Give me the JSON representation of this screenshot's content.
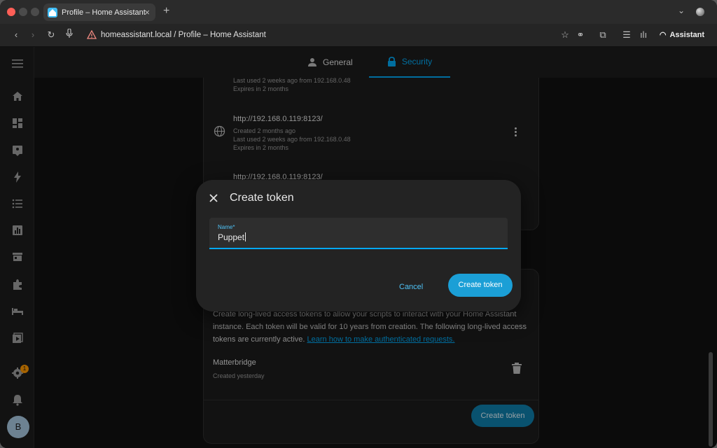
{
  "browser": {
    "tab_title": "Profile – Home Assistant",
    "url": "homeassistant.local / Profile – Home Assistant",
    "assistant_label": "Assistant"
  },
  "header": {
    "tabs": [
      {
        "label": "General",
        "icon": "account-icon",
        "active": false
      },
      {
        "label": "Security",
        "icon": "lock-icon",
        "active": true
      }
    ]
  },
  "sidebar": {
    "items": [
      "menu-icon",
      "home-icon",
      "dashboard-icon",
      "map-icon",
      "energy-icon",
      "logbook-icon",
      "history-icon",
      "hacs-icon",
      "addons-icon",
      "bed-icon",
      "media-icon"
    ],
    "settings_badge": "1",
    "avatar_initial": "B"
  },
  "tokens_top": [
    {
      "url": "",
      "created": "",
      "last_used": "Last used 2 weeks ago from 192.168.0.48",
      "expires": "Expires in 2 months"
    },
    {
      "url": "http://192.168.0.119:8123/",
      "created": "Created 2 months ago",
      "last_used": "Last used 2 weeks ago from 192.168.0.48",
      "expires": "Expires in 2 months"
    },
    {
      "url": "http://192.168.0.119:8123/"
    }
  ],
  "long_lived": {
    "description": "Create long-lived access tokens to allow your scripts to interact with your Home Assistant instance. Each token will be valid for 10 years from creation. The following long-lived access tokens are currently active.",
    "link_text": "Learn how to make authenticated requests.",
    "token_name": "Matterbridge",
    "token_created": "Created yesterday",
    "create_button": "Create token"
  },
  "dialog": {
    "title": "Create token",
    "field_label": "Name*",
    "field_value": "Puppet",
    "cancel_label": "Cancel",
    "create_label": "Create token"
  },
  "colors": {
    "accent": "#03a9f4",
    "primary_button": "#1b9fd6",
    "background": "#111111",
    "card": "#1c1c1c"
  }
}
